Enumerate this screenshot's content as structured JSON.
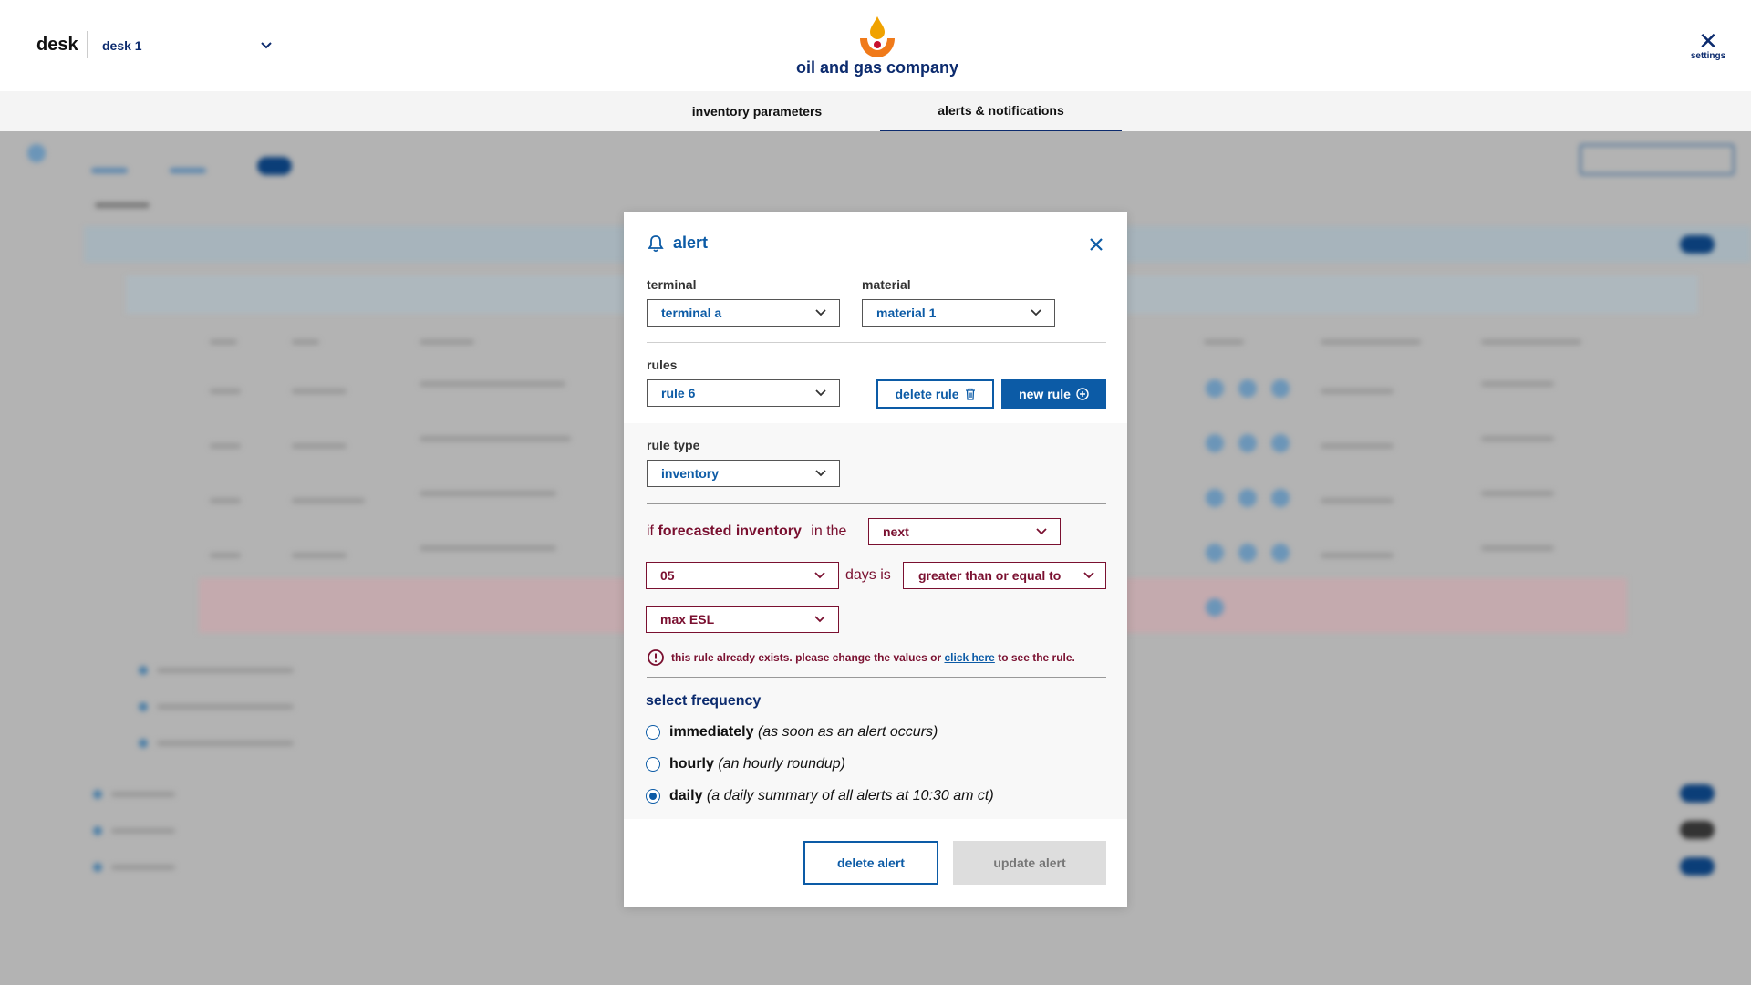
{
  "header": {
    "desk_label": "desk",
    "desk_value": "desk 1",
    "brand_name": "oil and gas company",
    "settings_label": "settings"
  },
  "tabs": [
    {
      "label": "inventory parameters",
      "active": false
    },
    {
      "label": "alerts & notifications",
      "active": true
    }
  ],
  "modal": {
    "title": "alert",
    "terminal_label": "terminal",
    "terminal_value": "terminal a",
    "material_label": "material",
    "material_value": "material 1",
    "rules_label": "rules",
    "rules_value": "rule 6",
    "delete_rule_label": "delete rule",
    "new_rule_label": "new rule",
    "rule_type_label": "rule type",
    "rule_type_value": "inventory",
    "condition": {
      "if_text": "if",
      "metric": "forecasted inventory",
      "in_the_text": "in the",
      "period_value": "next",
      "days_value": "05",
      "days_is_text": "days is",
      "operator_value": "greater than or equal to",
      "threshold_value": "max ESL"
    },
    "error": {
      "prefix": "this rule already exists. please change the values or",
      "link": "click here",
      "suffix": "to see the rule."
    },
    "frequency_title": "select frequency",
    "frequency_options": [
      {
        "label": "immediately",
        "desc": "(as soon as an alert occurs)",
        "selected": false
      },
      {
        "label": "hourly",
        "desc": "(an hourly roundup)",
        "selected": false
      },
      {
        "label": "daily",
        "desc": "(a daily summary of all alerts at 10:30 am ct)",
        "selected": true
      }
    ],
    "delete_alert_label": "delete alert",
    "update_alert_label": "update alert"
  },
  "colors": {
    "brand_navy": "#0c2b6e",
    "primary_blue": "#0c5ba6",
    "error_red": "#7a1030",
    "logo_orange": "#f0a200"
  }
}
